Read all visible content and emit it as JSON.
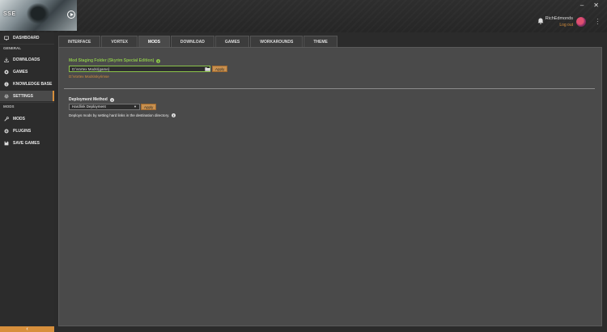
{
  "header": {
    "game_abbr": "SSE",
    "username": "RichEdmonds",
    "logout_label": "Log out",
    "window_controls": [
      "minimize-icon",
      "close-icon"
    ],
    "accent_color": "#d78f3c"
  },
  "sidebar": {
    "items": [
      {
        "label": "DASHBOARD",
        "icon": "dashboard-icon"
      },
      {
        "label": "DOWNLOADS",
        "icon": "download-icon"
      },
      {
        "label": "GAMES",
        "icon": "gamepad-icon"
      },
      {
        "label": "KNOWLEDGE BASE",
        "icon": "info-icon"
      },
      {
        "label": "SETTINGS",
        "icon": "gear-icon",
        "active": true
      },
      {
        "label": "MODS",
        "icon": "wrench-icon"
      },
      {
        "label": "PLUGINS",
        "icon": "puzzle-icon"
      },
      {
        "label": "SAVE GAMES",
        "icon": "floppy-icon"
      }
    ],
    "sections": {
      "general": "GENERAL",
      "mods": "MODS"
    },
    "collapse_glyph": "‹"
  },
  "tabs": [
    {
      "label": "INTERFACE"
    },
    {
      "label": "VORTEX"
    },
    {
      "label": "MODS",
      "active": true
    },
    {
      "label": "DOWNLOAD"
    },
    {
      "label": "GAMES"
    },
    {
      "label": "WORKAROUNDS"
    },
    {
      "label": "THEME"
    }
  ],
  "mods_settings": {
    "staging_label": "Mod Staging Folder (Skyrim Special Edition)",
    "staging_path": "D:\\Vortex Mods\\{game}",
    "apply_label": "Apply",
    "resolved_path": "D:\\Vortex Mods\\skyrimse",
    "deployment_label": "Deployment Method",
    "deployment_value": "Hardlink Deployment",
    "deployment_description": "Deploys mods by setting hard links in the destination directory."
  }
}
